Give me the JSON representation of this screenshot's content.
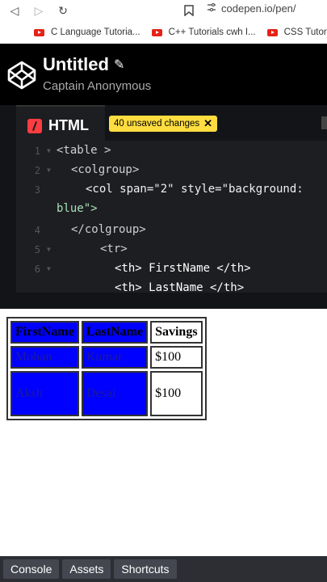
{
  "browser": {
    "url": "codepen.io/pen/",
    "bookmarks": [
      {
        "label": "C Language Tutoria..."
      },
      {
        "label": "C++ Tutorials cwh I..."
      },
      {
        "label": "CSS Tutoria"
      }
    ]
  },
  "pen": {
    "title": "Untitled",
    "owner": "Captain Anonymous"
  },
  "editor": {
    "tab_label": "HTML",
    "unsaved_label": "40 unsaved changes",
    "lines": [
      {
        "n": "1",
        "code": "<table >"
      },
      {
        "n": "2",
        "code": "<colgroup>"
      },
      {
        "n": "3",
        "code": "<col span=\"2\" style=\"background:"
      },
      {
        "n": "",
        "code": "blue\">"
      },
      {
        "n": "4",
        "code": "</colgroup>"
      },
      {
        "n": "5",
        "code": "<tr>"
      },
      {
        "n": "6",
        "code": "<th> FirstName </th>"
      },
      {
        "n": "",
        "code": "<th> LastName </th>"
      }
    ]
  },
  "preview": {
    "headers": [
      "FirstName",
      "LastName",
      "Savings"
    ],
    "rows": [
      [
        "Mohan",
        "Kumar",
        "$100"
      ],
      [
        "Aksh",
        "Desai",
        "$100"
      ]
    ]
  },
  "bottom": {
    "console": "Console",
    "assets": "Assets",
    "shortcuts": "Shortcuts"
  },
  "colors": {
    "unsaved_badge": "#ffdd40",
    "colgroup_bg": "#0000ff",
    "editor_bg": "#1d1e22"
  }
}
